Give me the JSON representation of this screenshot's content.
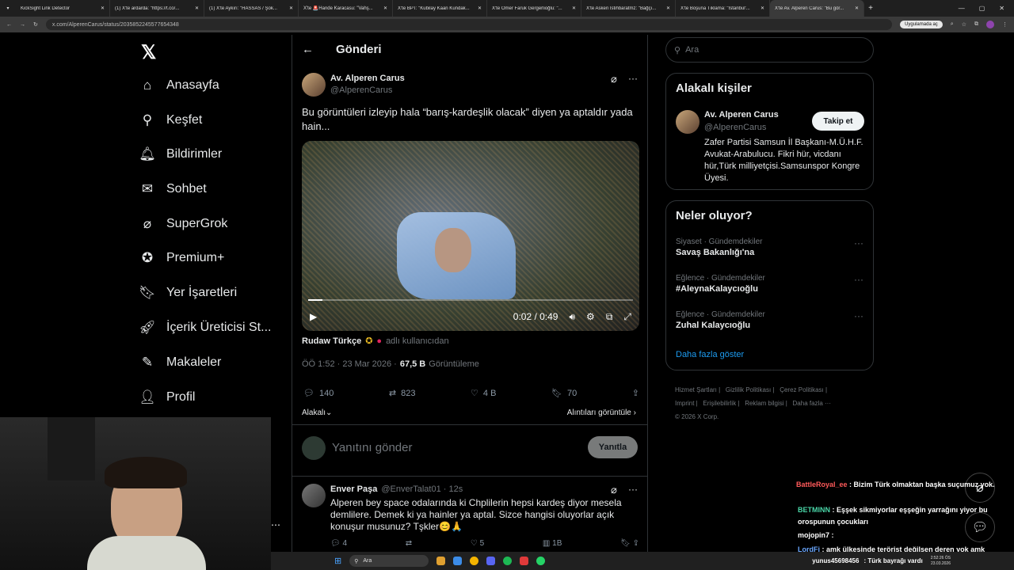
{
  "browser": {
    "tabs": [
      "KickSight Link Detector",
      "(1) X'te ardarda: \"https://t.co/...",
      "(1) X'te Aykırı: \"HASSAS / Şok...",
      "X'te 🚨Hande Karacasu: \"Vahş...",
      "X'te BPT: \"Kubilay Kaan Kundak...",
      "X'te Ömer Faruk Gergerlioğlu: \"...",
      "X'te Askeri İstihbaratmz: \"Bağçı...",
      "X'te Boşuna Tıklama: \"İstanbul'...",
      "X'te Av. Alperen Carus: \"Bu gör..."
    ],
    "url": "x.com/AlperenCarus/status/2035852245577654348",
    "update_label": "Uygulamada aç"
  },
  "nav": {
    "items": [
      "Anasayfa",
      "Keşfet",
      "Bildirimler",
      "Sohbet",
      "SuperGrok",
      "Premium+",
      "Yer İşaretleri",
      "İçerik Üreticisi St...",
      "Makaleler",
      "Profil"
    ]
  },
  "post": {
    "header_title": "Gönderi",
    "author_name": "Av. Alperen Carus",
    "author_handle": "@AlperenCarus",
    "text": "Bu görüntüleri izleyip hala “barış-kardeşlik olacak” diyen ya aptaldır yada hain...",
    "video_time": "0:02 / 0:49",
    "source_name": "Rudaw Türkçe",
    "source_suffix": "adlı kullanıcıdan",
    "time": "ÖÖ 1:52 · 23 Mar 2026 ·",
    "views": "67,5 B",
    "views_label": "Görüntüleme",
    "replies": "140",
    "reposts": "823",
    "likes": "4 B",
    "bookmarks": "70",
    "sort_label": "Alakalı",
    "quotes_label": "Alıntıları görüntüle",
    "reply_placeholder": "Yanıtını gönder",
    "reply_button": "Yanıtla"
  },
  "reply": {
    "name": "Enver Paşa",
    "handle": "@EnverTalat01 · 12s",
    "text": "Alperen bey space odalarında ki Chplilerin hepsi kardeş diyor mesela demlilere. Demek ki ya hainler ya aptal. Sizce hangisi oluyorlar açık konuşur musunuz? Tşkler😊🙏",
    "replies": "4",
    "likes": "5",
    "views": "1B"
  },
  "sidebar": {
    "search_placeholder": "Ara",
    "related_title": "Alakalı kişiler",
    "related_name": "Av. Alperen Carus",
    "related_handle": "@AlperenCarus",
    "follow_label": "Takip et",
    "related_bio": "Zafer Partisi Samsun İl Başkanı-M.Ü.H.F. Avukat-Arabulucu. Fikri hür, vicdanı hür,Türk milliyetçisi.Samsunspor Kongre Üyesi.",
    "trends_title": "Neler oluyor?",
    "trends": [
      {
        "category": "Siyaset · Gündemdekiler",
        "name": "Savaş Bakanlığı'na"
      },
      {
        "category": "Eğlence · Gündemdekiler",
        "name": "#AleynaKalaycıoğlu"
      },
      {
        "category": "Eğlence · Gündemdekiler",
        "name": "Zuhal Kalaycıoğlu"
      }
    ],
    "show_more": "Daha fazla göster",
    "footer": [
      "Hizmet Şartları |",
      "Gizlilik Politikası |",
      "Çerez Politikası |",
      "Imprint |",
      "Erişilebilirlik |",
      "Reklam bilgisi |",
      "Daha fazla ···",
      "© 2026 X Corp."
    ]
  },
  "chat": [
    {
      "user": "BattleRoyal_ee",
      "msg": ": Bizim Türk olmaktan başka suçumuz yok.",
      "color": "#ff5a5a"
    },
    {
      "user": "BETMINN",
      "msg": ": Eşşek sikmiyorlar eşşeğin yarrağını yiyor bu orospunun çocukları",
      "color": "#4ad6a8"
    },
    {
      "user": "mojopin7",
      "msg": ":",
      "color": "#ffffff"
    },
    {
      "user": "LordFi",
      "msg": ": amk ülkesinde terörist değilsen deren yok amk",
      "color": "#6aa7ff"
    },
    {
      "user": "yunus45698456",
      "msg": ": Türk bayrağı vardı",
      "color": "#ffffff"
    }
  ],
  "taskbar": {
    "search": "Ara",
    "time": "2:52:26 ÖS",
    "date": "23.03.2026"
  }
}
